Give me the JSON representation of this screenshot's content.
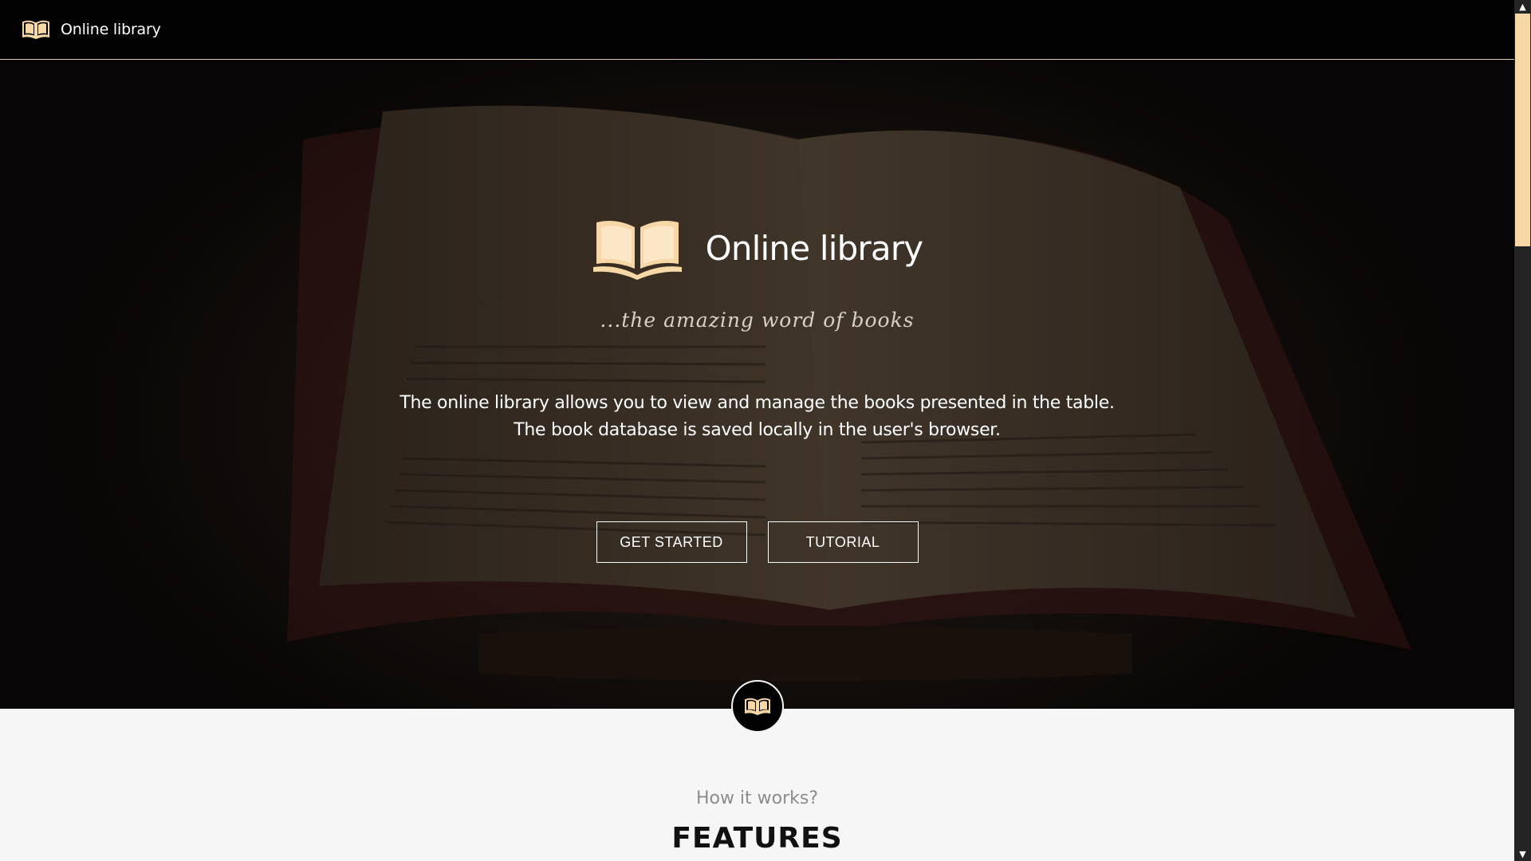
{
  "navbar": {
    "brand_icon": "open-book-icon",
    "brand_title": "Online library"
  },
  "hero": {
    "logo_icon": "open-book-icon",
    "title": "Online library",
    "tagline": "...the amazing word of books",
    "description": "The online library allows you to view and manage the books presented in the table. The book database is saved locally in the user's browser.",
    "buttons": {
      "get_started": "GET STARTED",
      "tutorial": "TUTORIAL"
    }
  },
  "scroll_badge": {
    "icon": "open-book-icon"
  },
  "features": {
    "subtitle": "How it works?",
    "title": "FEATURES"
  },
  "colors": {
    "accent": "#f7d7a6",
    "navbar_bg": "#020202",
    "section_bg": "#f6f6f6"
  },
  "scrollbar": {
    "up_glyph": "▲",
    "down_glyph": "▼",
    "position_fraction": 0.0
  }
}
